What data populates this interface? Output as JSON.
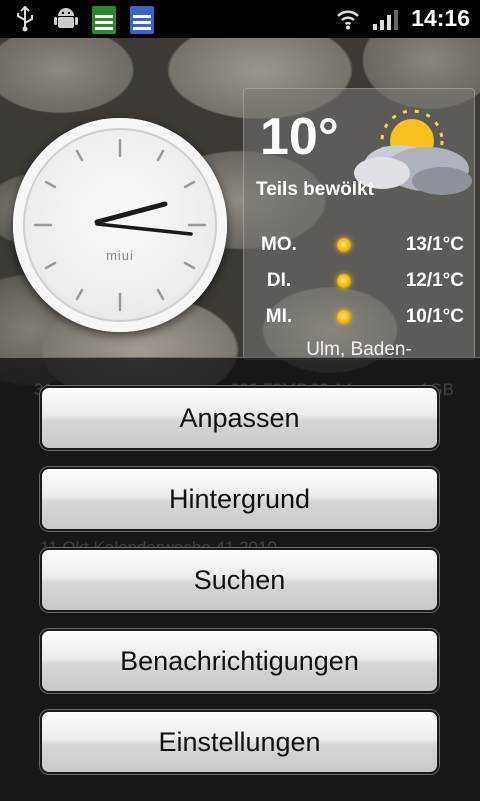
{
  "status_bar": {
    "left_icons": [
      "usb-icon",
      "android-debug-icon",
      "storage-green-icon",
      "storage-blue-icon"
    ],
    "right_icons": [
      "wifi-icon",
      "signal-icon"
    ],
    "time": "14:16"
  },
  "clock_widget": {
    "brand": "miui"
  },
  "weather_widget": {
    "temperature": "10°",
    "condition": "Teils bewölkt",
    "forecast": [
      {
        "day": "MO.",
        "temp": "13/1°C"
      },
      {
        "day": "DI.",
        "temp": "12/1°C"
      },
      {
        "day": "MI.",
        "temp": "10/1°C"
      }
    ],
    "location": "Ulm, Baden-"
  },
  "background_ghost": {
    "storage_text": "31",
    "storage_text_2": "230,78MB",
    "storage_text_3": "00,14",
    "storage_text_4": "1GB",
    "calendar_text": "11 Okt Kalenderwoche 41 2010"
  },
  "menu": {
    "items": [
      {
        "label": "Anpassen"
      },
      {
        "label": "Hintergrund"
      },
      {
        "label": "Suchen"
      },
      {
        "label": "Benachrichtigungen"
      },
      {
        "label": "Einstellungen"
      }
    ]
  }
}
